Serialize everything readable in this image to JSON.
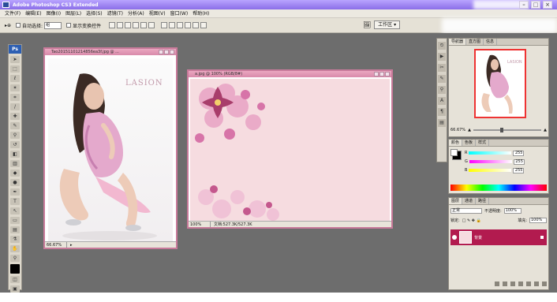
{
  "window": {
    "title": "Adobe Photoshop CS3 Extended"
  },
  "menubar": {
    "items": [
      "文件(F)",
      "编辑(E)",
      "图像(I)",
      "图层(L)",
      "选择(S)",
      "滤镜(T)",
      "分析(A)",
      "视图(V)",
      "窗口(W)",
      "帮助(H)"
    ]
  },
  "options": {
    "auto_select_label": "自动选择:",
    "auto_select_value": "组",
    "show_transform_label": "显示变换控件",
    "workspace_label": "工作区 ▾"
  },
  "toolbox": {
    "logo": "Ps"
  },
  "doc1": {
    "title": "Tao20151101214856ea3f.jpg @ ...",
    "zoom": "66.67%",
    "photo_logo": "LASION"
  },
  "doc2": {
    "title": "a.jpg @ 100% (RGB/8#)",
    "zoom": "100%",
    "info": "文档:527.3K/527.3K"
  },
  "navigator": {
    "tabs": [
      "导航器",
      "直方图",
      "信息"
    ],
    "zoom": "66.67%",
    "logo": "LASION"
  },
  "color_panel": {
    "tabs": [
      "颜色",
      "色板",
      "样式"
    ],
    "rows": [
      {
        "label": "R",
        "value": "255"
      },
      {
        "label": "G",
        "value": "255"
      },
      {
        "label": "B",
        "value": "255"
      }
    ]
  },
  "layers_panel": {
    "tabs": [
      "图层",
      "通道",
      "路径"
    ],
    "blend_mode": "正常",
    "opacity_label": "不透明度:",
    "opacity": "100%",
    "lock_label": "锁定:",
    "fill_label": "填充:",
    "fill": "100%",
    "layer_name": "背景"
  },
  "colors": {
    "accent": "#b21b4f",
    "doc_border": "#c87a9a",
    "workspace": "#6d6d6d"
  }
}
